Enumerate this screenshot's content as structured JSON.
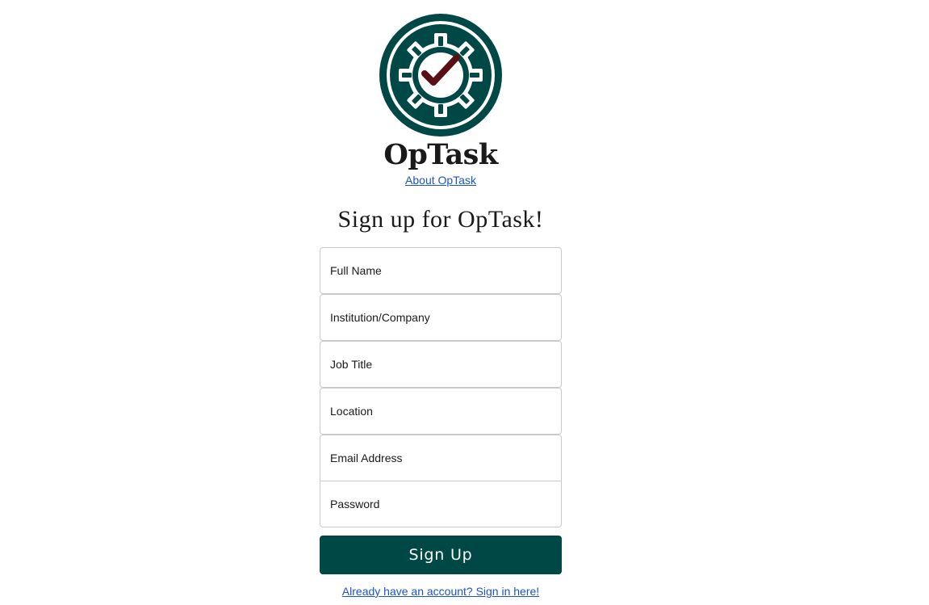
{
  "brand": {
    "name": "OpTask",
    "about_link": "About OpTask",
    "logo_icon": "gear-checkmark-icon",
    "colors": {
      "primary": "#004845",
      "check": "#5a0f14",
      "link": "#1a55c8"
    }
  },
  "form": {
    "title": "Sign up for OpTask!",
    "fields": {
      "full_name": {
        "placeholder": "Full Name",
        "value": ""
      },
      "institution": {
        "placeholder": "Institution/Company",
        "value": ""
      },
      "job_title": {
        "placeholder": "Job Title",
        "value": ""
      },
      "location": {
        "placeholder": "Location",
        "value": ""
      },
      "email": {
        "placeholder": "Email Address",
        "value": ""
      },
      "password": {
        "placeholder": "Password",
        "value": ""
      }
    },
    "submit_label": "Sign Up",
    "signin_link": "Already have an account? Sign in here!"
  }
}
